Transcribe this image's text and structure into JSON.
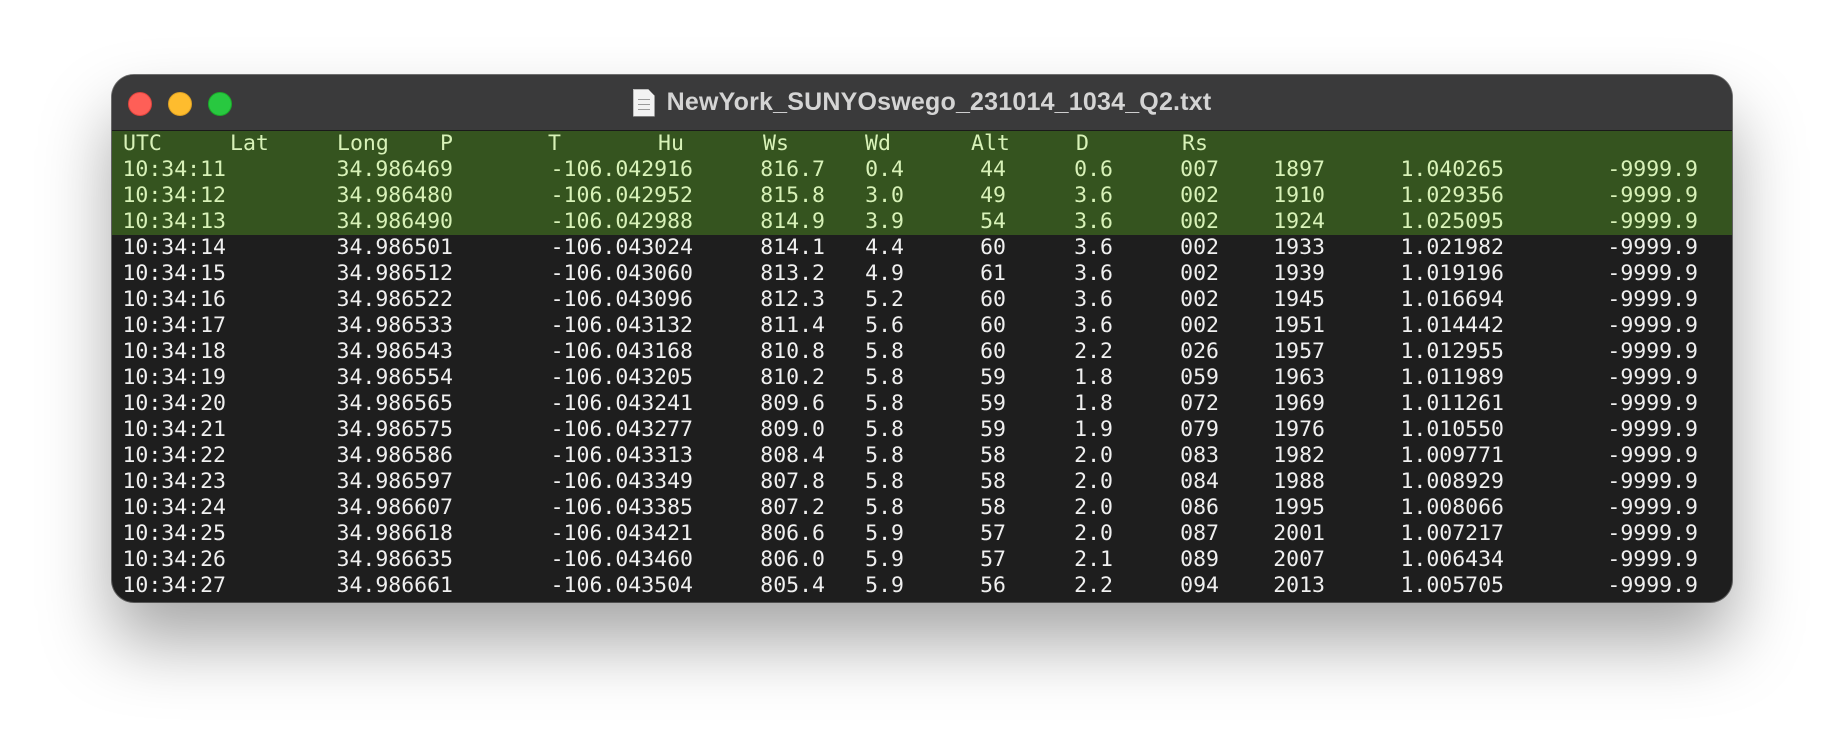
{
  "window": {
    "title": "NewYork_SUNYOswego_231014_1034_Q2.txt",
    "icons": {
      "close": "close-button",
      "minimize": "minimize-button",
      "zoom": "zoom-button",
      "document": "document-icon"
    }
  },
  "colors": {
    "selection_bg": "#35541f",
    "selection_text": "#d8f2b8",
    "text": "#f0f0f0",
    "background": "#1e1e1e",
    "titlebar": "#3a3a3b"
  },
  "header_line": [
    "UTC",
    "Lat",
    "Long",
    "P",
    "T",
    "Hu",
    "Ws",
    "Wd",
    "Alt",
    "D",
    "Rs"
  ],
  "rows": [
    [
      "10:34:11",
      "34.986469",
      "-106.042916",
      "816.7",
      "0.4",
      "44",
      "0.6",
      "007",
      "1897",
      "1.040265",
      "-9999.9"
    ],
    [
      "10:34:12",
      "34.986480",
      "-106.042952",
      "815.8",
      "3.0",
      "49",
      "3.6",
      "002",
      "1910",
      "1.029356",
      "-9999.9"
    ],
    [
      "10:34:13",
      "34.986490",
      "-106.042988",
      "814.9",
      "3.9",
      "54",
      "3.6",
      "002",
      "1924",
      "1.025095",
      "-9999.9"
    ],
    [
      "10:34:14",
      "34.986501",
      "-106.043024",
      "814.1",
      "4.4",
      "60",
      "3.6",
      "002",
      "1933",
      "1.021982",
      "-9999.9"
    ],
    [
      "10:34:15",
      "34.986512",
      "-106.043060",
      "813.2",
      "4.9",
      "61",
      "3.6",
      "002",
      "1939",
      "1.019196",
      "-9999.9"
    ],
    [
      "10:34:16",
      "34.986522",
      "-106.043096",
      "812.3",
      "5.2",
      "60",
      "3.6",
      "002",
      "1945",
      "1.016694",
      "-9999.9"
    ],
    [
      "10:34:17",
      "34.986533",
      "-106.043132",
      "811.4",
      "5.6",
      "60",
      "3.6",
      "002",
      "1951",
      "1.014442",
      "-9999.9"
    ],
    [
      "10:34:18",
      "34.986543",
      "-106.043168",
      "810.8",
      "5.8",
      "60",
      "2.2",
      "026",
      "1957",
      "1.012955",
      "-9999.9"
    ],
    [
      "10:34:19",
      "34.986554",
      "-106.043205",
      "810.2",
      "5.8",
      "59",
      "1.8",
      "059",
      "1963",
      "1.011989",
      "-9999.9"
    ],
    [
      "10:34:20",
      "34.986565",
      "-106.043241",
      "809.6",
      "5.8",
      "59",
      "1.8",
      "072",
      "1969",
      "1.011261",
      "-9999.9"
    ],
    [
      "10:34:21",
      "34.986575",
      "-106.043277",
      "809.0",
      "5.8",
      "59",
      "1.9",
      "079",
      "1976",
      "1.010550",
      "-9999.9"
    ],
    [
      "10:34:22",
      "34.986586",
      "-106.043313",
      "808.4",
      "5.8",
      "58",
      "2.0",
      "083",
      "1982",
      "1.009771",
      "-9999.9"
    ],
    [
      "10:34:23",
      "34.986597",
      "-106.043349",
      "807.8",
      "5.8",
      "58",
      "2.0",
      "084",
      "1988",
      "1.008929",
      "-9999.9"
    ],
    [
      "10:34:24",
      "34.986607",
      "-106.043385",
      "807.2",
      "5.8",
      "58",
      "2.0",
      "086",
      "1995",
      "1.008066",
      "-9999.9"
    ],
    [
      "10:34:25",
      "34.986618",
      "-106.043421",
      "806.6",
      "5.9",
      "57",
      "2.0",
      "087",
      "2001",
      "1.007217",
      "-9999.9"
    ],
    [
      "10:34:26",
      "34.986635",
      "-106.043460",
      "806.0",
      "5.9",
      "57",
      "2.1",
      "089",
      "2007",
      "1.006434",
      "-9999.9"
    ],
    [
      "10:34:27",
      "34.986661",
      "-106.043504",
      "805.4",
      "5.9",
      "56",
      "2.2",
      "094",
      "2013",
      "1.005705",
      "-9999.9"
    ]
  ],
  "selected_row_count": 3
}
